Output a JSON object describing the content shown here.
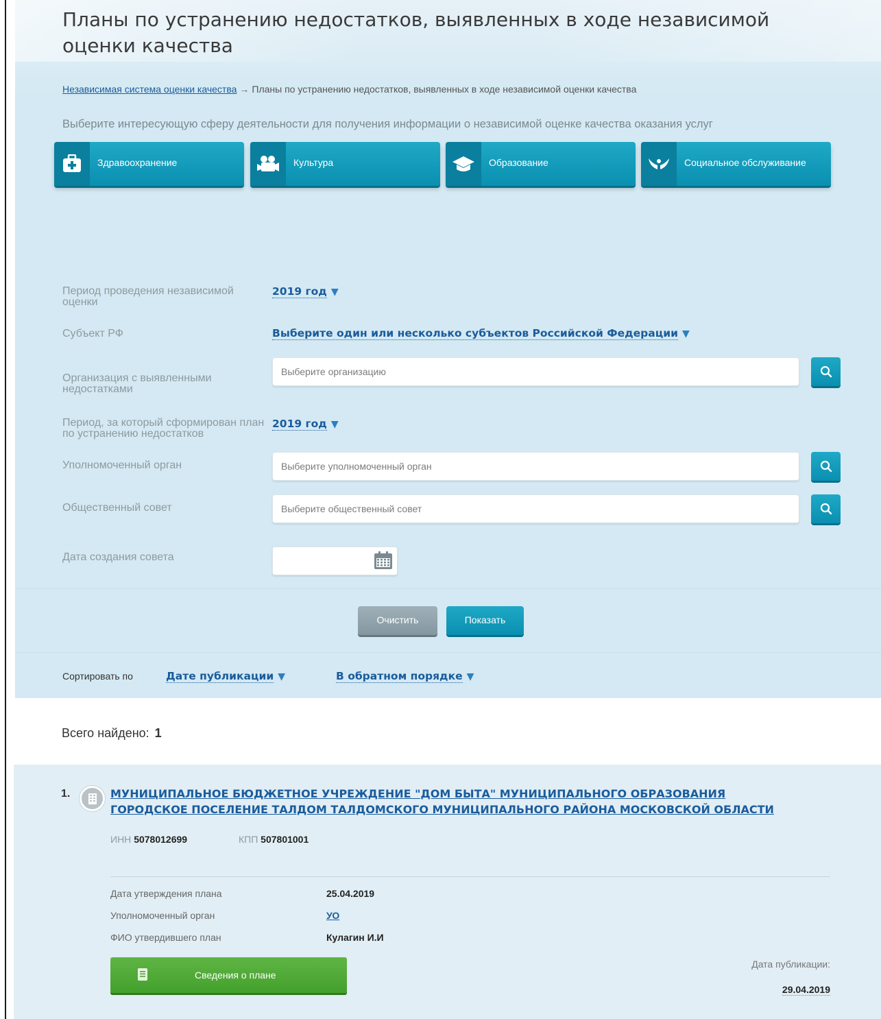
{
  "page": {
    "title": "Планы по устранению недостатков, выявленных в ходе независимой оценки качества"
  },
  "breadcrumb": {
    "home": "Независимая система оценки качества",
    "separator": "→",
    "current": "Планы по устранению недостатков, выявленных в ходе независимой оценки качества"
  },
  "hint": "Выберите интересующую сферу деятельности для получения информации о независимой оценке качества оказания услуг",
  "spheres": [
    {
      "label": "Здравоохранение",
      "icon": "medical-kit-icon"
    },
    {
      "label": "Культура",
      "icon": "film-camera-icon"
    },
    {
      "label": "Образование",
      "icon": "graduation-cap-icon"
    },
    {
      "label": "Социальное обслуживание",
      "icon": "caring-hands-icon"
    }
  ],
  "filters": {
    "period_label": "Период проведения независимой оценки",
    "period_value": "2019 год",
    "subject_label": "Субъект РФ",
    "subject_value": "Выберите один или несколько субъектов Российской Федерации",
    "org_label": "Организация с выявленными недостатками",
    "org_placeholder": "Выберите организацию",
    "plan_period_label": "Период, за который сформирован план по устранению недостатков",
    "plan_period_value": "2019 год",
    "authority_label": "Уполномоченный орган",
    "authority_placeholder": "Выберите уполномоченный орган",
    "council_label": "Общественный совет",
    "council_placeholder": "Выберите общественный совет",
    "council_date_label": "Дата создания совета"
  },
  "actions": {
    "clear": "Очистить",
    "show": "Показать"
  },
  "sort": {
    "label": "Сортировать по",
    "field": "Дате публикации",
    "order": "В обратном порядке"
  },
  "results": {
    "total_label": "Всего найдено:",
    "total_count": "1",
    "items": [
      {
        "number": "1.",
        "title": "МУНИЦИПАЛЬНОЕ БЮДЖЕТНОЕ УЧРЕЖДЕНИЕ \"ДОМ БЫТА\" МУНИЦИПАЛЬНОГО ОБРАЗОВАНИЯ ГОРОДСКОЕ ПОСЕЛЕНИЕ ТАЛДОМ ТАЛДОМСКОГО МУНИЦИПАЛЬНОГО РАЙОНА МОСКОВСКОЙ ОБЛАСТИ",
        "inn_label": "ИНН",
        "inn": "5078012699",
        "kpp_label": "КПП",
        "kpp": "507801001",
        "approval_date_label": "Дата утверждения плана",
        "approval_date": "25.04.2019",
        "authority_label": "Уполномоченный орган",
        "authority": "УО",
        "approver_label": "ФИО утвердившего план",
        "approver": "Кулагин И.И",
        "plan_button": "Сведения о плане",
        "pub_label": "Дата публикации:",
        "pub_date": "29.04.2019"
      }
    ]
  },
  "colors": {
    "panel_bg": "#d4e9f3",
    "accent": "#0a8fb0",
    "link": "#1a5c9c",
    "green_button": "#4aa532",
    "gray_button": "#8a9ca5"
  }
}
